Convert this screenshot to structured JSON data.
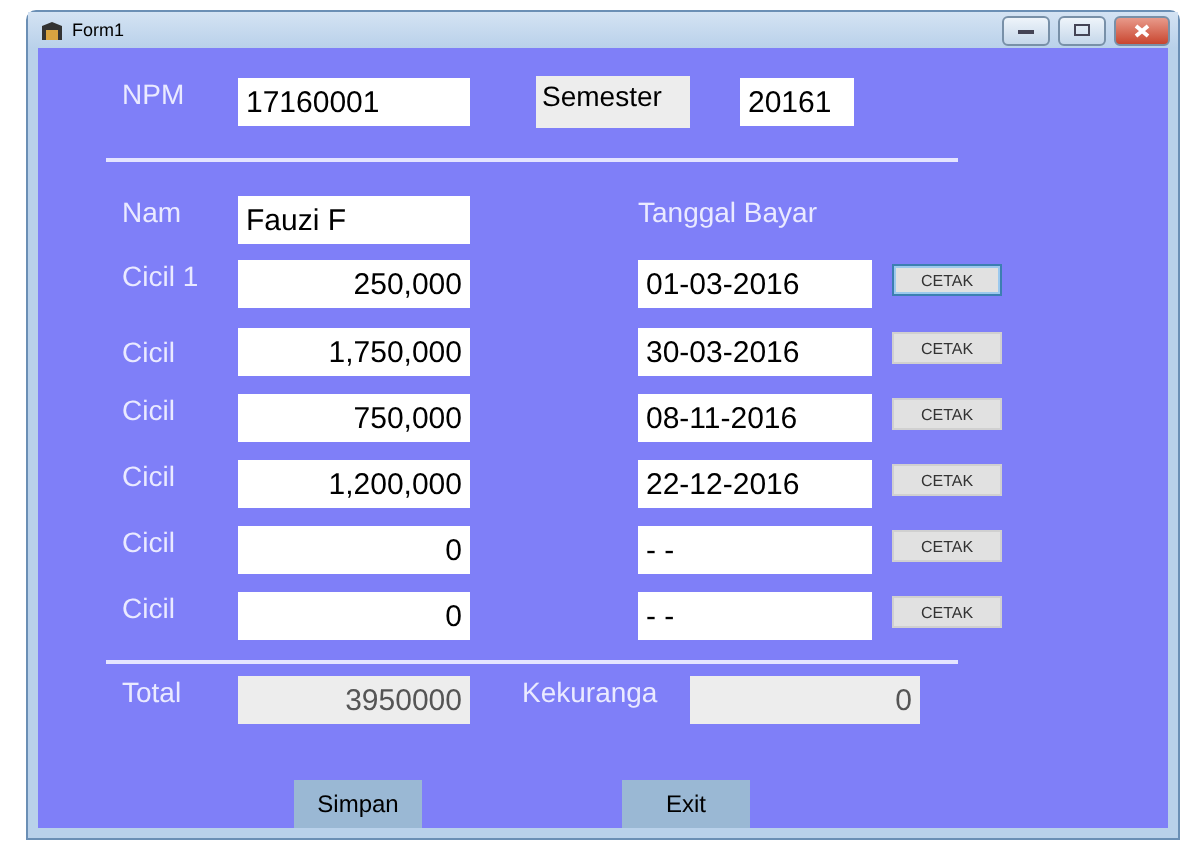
{
  "window": {
    "title": "Form1"
  },
  "header": {
    "npm_label": "NPM",
    "npm_value": "17160001",
    "semester_label": "Semester",
    "semester_value": "20161"
  },
  "nama": {
    "label": "Nam",
    "value": "Fauzi F"
  },
  "date_heading": "Tanggal Bayar",
  "installments": [
    {
      "label": "Cicil 1",
      "amount": "250,000",
      "date": "01-03-2016",
      "button": "CETAK",
      "focused": true
    },
    {
      "label": "Cicil",
      "amount": "1,750,000",
      "date": "30-03-2016",
      "button": "CETAK",
      "focused": false
    },
    {
      "label": "Cicil",
      "amount": "750,000",
      "date": "08-11-2016",
      "button": "CETAK",
      "focused": false
    },
    {
      "label": "Cicil",
      "amount": "1,200,000",
      "date": "22-12-2016",
      "button": "CETAK",
      "focused": false
    },
    {
      "label": "Cicil",
      "amount": "0",
      "date": "- -",
      "button": "CETAK",
      "focused": false
    },
    {
      "label": "Cicil",
      "amount": "0",
      "date": "- -",
      "button": "CETAK",
      "focused": false
    }
  ],
  "totals": {
    "total_label": "Total",
    "total_value": "3950000",
    "remaining_label": "Kekuranga",
    "remaining_value": "0"
  },
  "buttons": [
    "Simpan",
    "Exit"
  ]
}
